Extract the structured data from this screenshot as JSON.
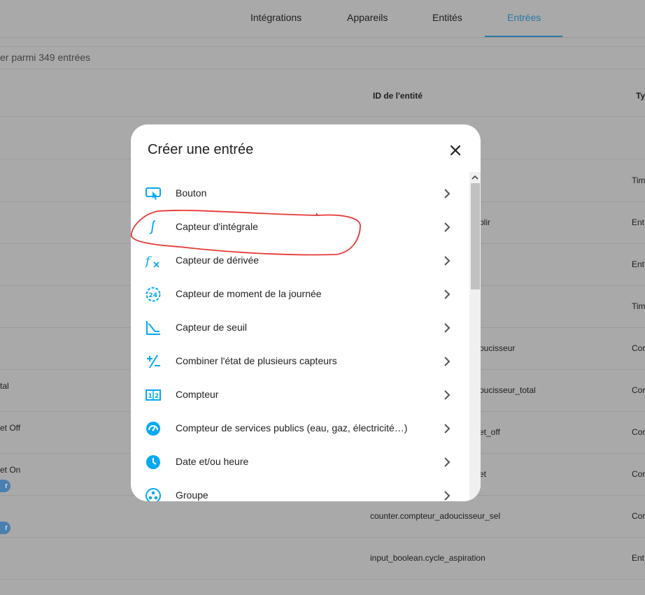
{
  "tabs": [
    {
      "label": "Intégrations"
    },
    {
      "label": "Appareils"
    },
    {
      "label": "Entités"
    },
    {
      "label": "Entrées"
    }
  ],
  "search": {
    "text": "er parmi 349 entrées"
  },
  "table": {
    "columns": [
      "ID de l'entité",
      "Ty"
    ],
    "rows": [
      {
        "name": "",
        "entity_id": "",
        "type": ""
      },
      {
        "name": "",
        "entity_id": "",
        "type": "Tim"
      },
      {
        "name": "",
        "entity_id": "plir",
        "type": "Ent"
      },
      {
        "name": "",
        "entity_id": "",
        "type": "Ent"
      },
      {
        "name": "",
        "entity_id": "",
        "type": "Tim"
      },
      {
        "name": "",
        "entity_id": "oucisseur",
        "type": "Cor"
      },
      {
        "name": "tal",
        "entity_id": "oucisseur_total",
        "type": "Cor"
      },
      {
        "name": "et Off",
        "entity_id": "et_off",
        "type": "Cor"
      },
      {
        "name": "et On",
        "entity_id": "et",
        "type": "Cor",
        "chip": "r"
      },
      {
        "name": "",
        "entity_id": "counter.compteur_adoucisseur_sel",
        "type": "Cor",
        "chip": "r"
      },
      {
        "name": "",
        "entity_id": "input_boolean.cycle_aspiration",
        "type": "Ent"
      }
    ]
  },
  "dialog": {
    "title": "Créer une entrée",
    "items": [
      {
        "label": "Bouton",
        "icon": "gesture-tap-button-icon"
      },
      {
        "label": "Capteur d'intégrale",
        "icon": "integral-icon"
      },
      {
        "label": "Capteur de dérivée",
        "icon": "function-variant-icon"
      },
      {
        "label": "Capteur de moment de la journée",
        "icon": "hours-24-icon"
      },
      {
        "label": "Capteur de seuil",
        "icon": "threshold-chart-icon"
      },
      {
        "label": "Combiner l'état de plusieurs capteurs",
        "icon": "plus-minus-icon"
      },
      {
        "label": "Compteur",
        "icon": "counter-icon"
      },
      {
        "label": "Compteur de services publics (eau, gaz, électricité…)",
        "icon": "gauge-icon"
      },
      {
        "label": "Date et/ou heure",
        "icon": "clock-icon"
      },
      {
        "label": "Groupe",
        "icon": "group-icon"
      }
    ]
  },
  "colors": {
    "accent": "#03a9f4",
    "annotation": "#e53935",
    "active_tab": "#2a78a8"
  }
}
